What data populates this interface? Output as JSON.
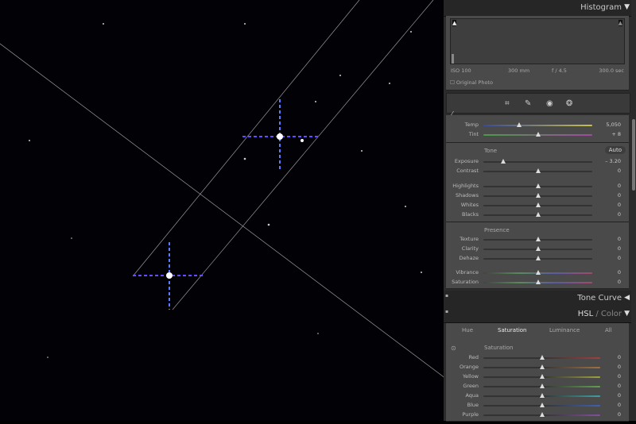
{
  "histogram": {
    "title": "Histogram",
    "iso": "ISO 100",
    "focal": "300 mm",
    "aperture": "f / 4.5",
    "shutter": "300.0 sec",
    "original_photo": "Original Photo"
  },
  "tools": [
    "crop-icon",
    "healing-icon",
    "red-eye-icon",
    "mask-icon"
  ],
  "wb": [
    {
      "label": "Temp",
      "value": "5,050",
      "pos": 0.33,
      "grad": "linear-gradient(90deg,#3a4a9a,#c8c050)"
    },
    {
      "label": "Tint",
      "value": "+ 8",
      "pos": 0.5,
      "grad": "linear-gradient(90deg,#4a9a4a,#a04aa0)"
    }
  ],
  "tone": {
    "title": "Tone",
    "auto": "Auto",
    "sliders": [
      {
        "label": "Exposure",
        "value": "– 3.20",
        "pos": 0.18
      },
      {
        "label": "Contrast",
        "value": "0",
        "pos": 0.5
      }
    ]
  },
  "tone2": [
    {
      "label": "Highlights",
      "value": "0",
      "pos": 0.5
    },
    {
      "label": "Shadows",
      "value": "0",
      "pos": 0.5
    },
    {
      "label": "Whites",
      "value": "0",
      "pos": 0.5
    },
    {
      "label": "Blacks",
      "value": "0",
      "pos": 0.5
    }
  ],
  "presence": {
    "title": "Presence",
    "sliders": [
      {
        "label": "Texture",
        "value": "0",
        "pos": 0.5
      },
      {
        "label": "Clarity",
        "value": "0",
        "pos": 0.5
      },
      {
        "label": "Dehaze",
        "value": "0",
        "pos": 0.5
      }
    ]
  },
  "presence2": [
    {
      "label": "Vibrance",
      "value": "0",
      "pos": 0.5
    },
    {
      "label": "Saturation",
      "value": "0",
      "pos": 0.5
    }
  ],
  "tone_curve": {
    "title": "Tone Curve"
  },
  "hsl": {
    "title": "HSL",
    "title2": "/ Color",
    "tabs": [
      "Hue",
      "Saturation",
      "Luminance",
      "All"
    ],
    "active_tab": 1,
    "section": "Saturation",
    "sliders": [
      {
        "label": "Red",
        "value": "0",
        "pos": 0.5,
        "color": "#a04040"
      },
      {
        "label": "Orange",
        "value": "0",
        "pos": 0.5,
        "color": "#a07040"
      },
      {
        "label": "Yellow",
        "value": "0",
        "pos": 0.5,
        "color": "#a0a040"
      },
      {
        "label": "Green",
        "value": "0",
        "pos": 0.5,
        "color": "#60a050"
      },
      {
        "label": "Aqua",
        "value": "0",
        "pos": 0.5,
        "color": "#40a0a0"
      },
      {
        "label": "Blue",
        "value": "0",
        "pos": 0.5,
        "color": "#4060b0"
      },
      {
        "label": "Purple",
        "value": "0",
        "pos": 0.5,
        "color": "#8050a0"
      }
    ]
  }
}
